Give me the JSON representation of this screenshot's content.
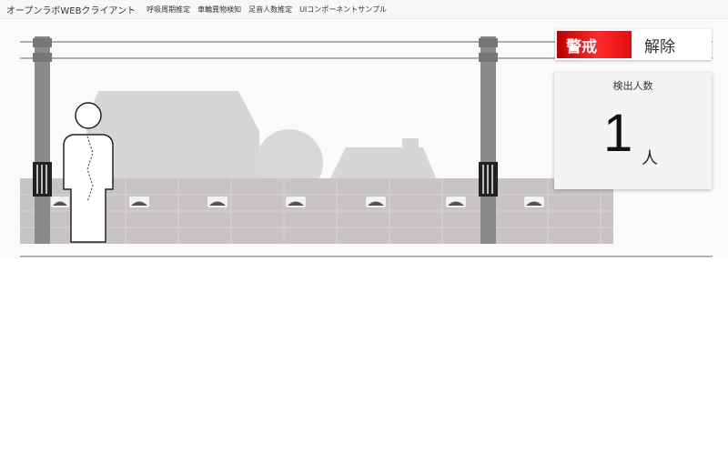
{
  "navbar": {
    "brand": "オープンラボWEBクライアント",
    "links": [
      "呼吸周期推定",
      "車輪異物検知",
      "足音人数推定",
      "UIコンポーネントサンプル"
    ]
  },
  "alert": {
    "status_label": "警戒",
    "release_label": "解除",
    "badge_color": "#e01010"
  },
  "counter": {
    "title": "検出人数",
    "value": "1",
    "unit": "人"
  },
  "icons": {
    "person": "person-silhouette-icon"
  }
}
